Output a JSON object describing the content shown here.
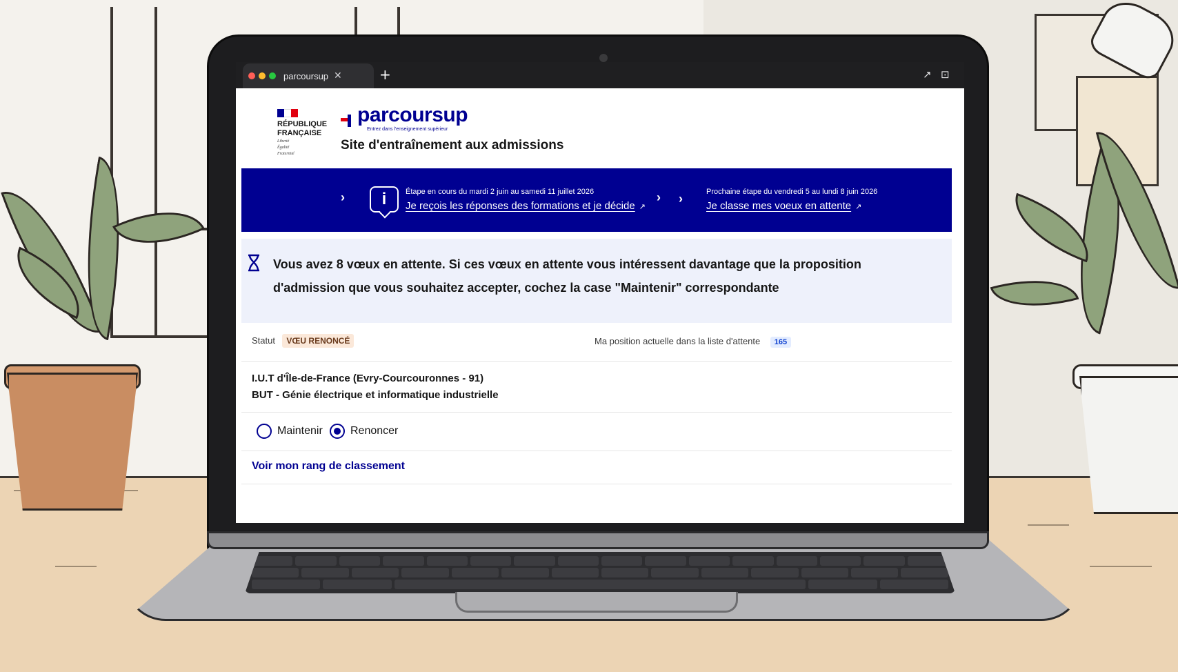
{
  "browser": {
    "tab_title": "parcoursup",
    "tab_close": "✕",
    "new_tab": "+"
  },
  "header": {
    "republic_line1": "RÉPUBLIQUE",
    "republic_line2": "FRANÇAISE",
    "motto_1": "Liberté",
    "motto_2": "Égalité",
    "motto_3": "Fraternité",
    "logo_word": "parcoursup",
    "logo_tagline": "Entrez dans l'enseignement supérieur",
    "site_title": "Site d'entraînement aux admissions"
  },
  "steps": {
    "current_date": "Étape en cours du mardi 2 juin au samedi 11 juillet 2026",
    "current_link": "Je reçois les réponses des formations et je décide",
    "next_date": "Prochaine étape du vendredi 5 au lundi 8 juin 2026",
    "next_link": "Je classe mes voeux en attente"
  },
  "alert": {
    "text": "Vous avez 8 vœux en attente. Si ces vœux en attente vous intéressent davantage que la proposition d'admission que vous souhaitez accepter, cochez la case \"Maintenir\"   correspondante"
  },
  "wish": {
    "status_label": "Statut",
    "status_value": "VŒU RENONCÉ",
    "position_label": "Ma position actuelle dans la liste d'attente",
    "position_value": "165",
    "school": "I.U.T d'Île-de-France (Evry-Courcouronnes - 91)",
    "program": "BUT - Génie électrique et informatique industrielle",
    "option_keep": "Maintenir",
    "option_renounce": "Renoncer",
    "selected": "Renoncer",
    "rank_link": "Voir mon rang de classement"
  },
  "colors": {
    "brand_blue": "#000091",
    "brand_red": "#e1000f",
    "alert_bg": "#eef1fb"
  }
}
